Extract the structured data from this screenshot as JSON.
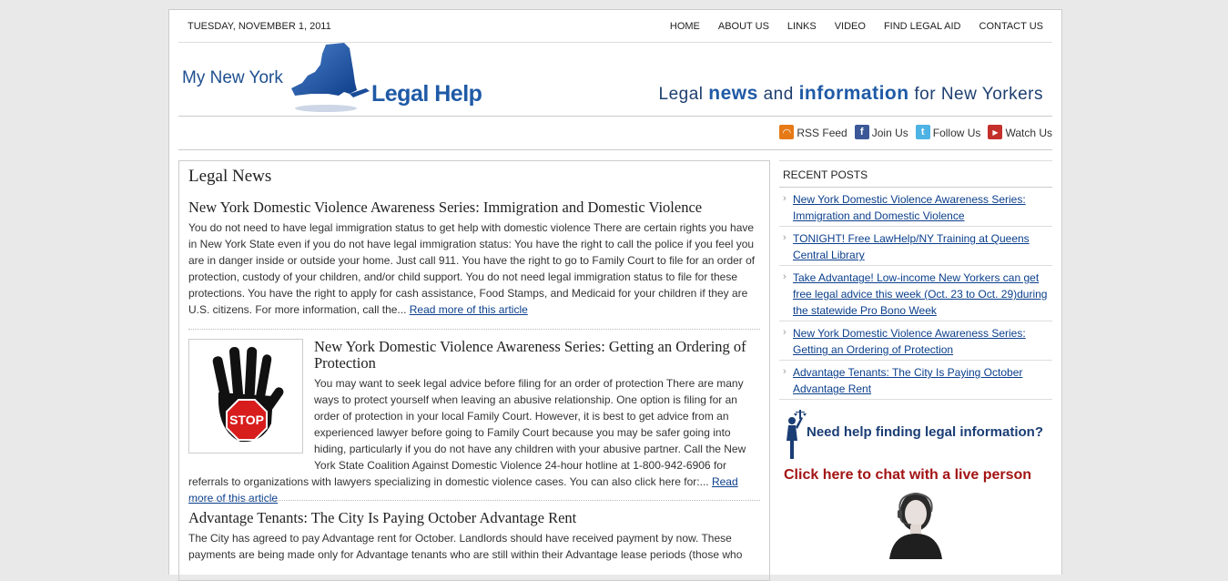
{
  "topbar": {
    "date": "TUESDAY, NOVEMBER 1, 2011",
    "nav": [
      "HOME",
      "ABOUT US",
      "LINKS",
      "VIDEO",
      "FIND LEGAL AID",
      "CONTACT US"
    ]
  },
  "header": {
    "logo_my": "My New York",
    "logo_legal": "Legal Help",
    "tagline_1": "Legal ",
    "tagline_2": "news",
    "tagline_3": " and ",
    "tagline_4": "information",
    "tagline_5": " for New Yorkers"
  },
  "social": {
    "rss": "RSS Feed",
    "facebook": "Join Us",
    "twitter": "Follow Us",
    "youtube": "Watch Us"
  },
  "main": {
    "title": "Legal News",
    "articles": [
      {
        "title": "New York Domestic Violence Awareness Series: Immigration and Domestic Violence",
        "body": "You do not need to have legal immigration status to get help with domestic violence There are certain rights you have in New York State even if you do not have legal immigration status: You have the right to call the police if you feel you are in danger inside or outside your home.  Just call 911. You have the right to go to Family Court to file for an order of protection, custody of your children, and/or child support.  You do not need legal immigration status to file for these protections. You have the right to apply for cash assistance, Food Stamps, and Medicaid for your children if they are U.S. citizens. For more information, call the... ",
        "more": "Read more of this article"
      },
      {
        "title": "New York Domestic Violence Awareness Series: Getting an Ordering of Protection",
        "body": "You may want to seek legal advice before filing for an order of protection There are many ways to protect yourself when leaving an abusive relationship.  One option is filing for an order of protection in your local Family Court.  However, it is best to get advice from an experienced lawyer before going to Family Court because you may be safer going into hiding, particularly if you do not have any children with your abusive partner.  Call the New York State Coalition Against Domestic Violence 24-hour hotline at 1-800-942-6906 for referrals to organizations with lawyers specializing in domestic violence cases. You can also click here for:... ",
        "more": "Read more of this article",
        "image_text": "STOP"
      },
      {
        "title": "Advantage Tenants: The City Is Paying October Advantage Rent",
        "body": "The City has agreed to pay Advantage rent for October. Landlords should have received payment by now. These payments are being made only for Advantage tenants who are still within their Advantage lease periods (those who"
      }
    ]
  },
  "sidebar": {
    "recent_title": "RECENT POSTS",
    "recent": [
      "New York Domestic Violence Awareness Series: Immigration and Domestic Violence",
      "TONIGHT! Free LawHelp/NY Training at Queens Central Library",
      "Take Advantage! Low-income New Yorkers can get free legal advice this week (Oct. 23 to Oct. 29)during the statewide Pro Bono Week",
      "New York Domestic Violence Awareness Series: Getting an Ordering of Protection",
      "Advantage Tenants: The City Is Paying October Advantage Rent"
    ],
    "need_help": "Need help finding legal information?",
    "chat": "Click here to chat with a live person"
  },
  "colors": {
    "link": "#0b3f8c",
    "brand": "#1f5aa6",
    "chat": "#a31414"
  }
}
